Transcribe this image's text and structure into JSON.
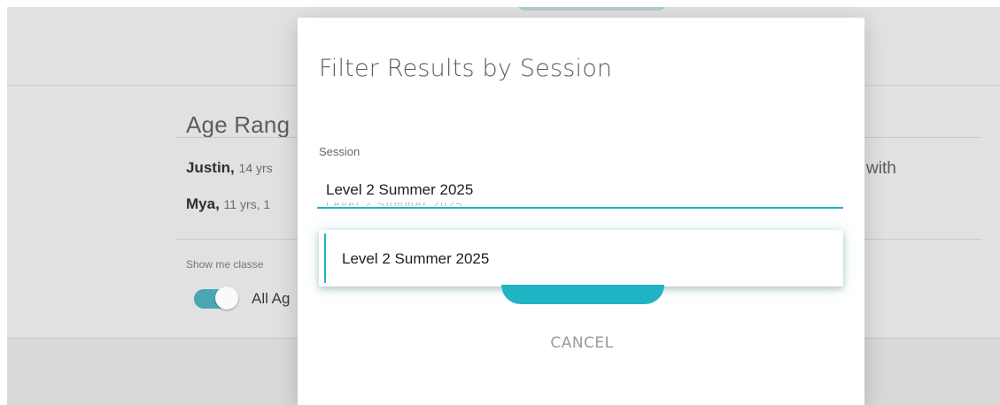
{
  "background": {
    "age_range_title": "Age Rang",
    "children": [
      {
        "name": "Justin,",
        "meta": "14 yrs"
      },
      {
        "name": "Mya,",
        "meta": "11 yrs, 1"
      }
    ],
    "with_text": "with",
    "show_me_label": "Show me classe",
    "toggle_label": "All Ag",
    "toggle_on": true
  },
  "modal": {
    "title": "Filter Results by Session",
    "session_label": "Session",
    "session_value": "Level 2 Summer 2025",
    "dropdown_options": [
      "Level 2 Summer 2025"
    ],
    "cancel_label": "CANCEL"
  },
  "colors": {
    "accent": "#20b3c4",
    "toggle": "#49a7b3",
    "overlay": "#e1e1e1"
  }
}
